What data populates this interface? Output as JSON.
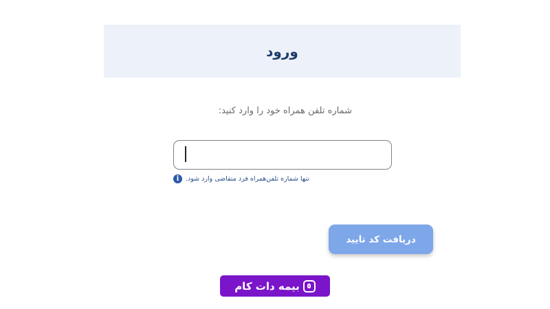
{
  "header": {
    "title": "ورود"
  },
  "form": {
    "prompt": "شماره تلفن همراه خود را وارد کنید:",
    "phone_input": {
      "value": "",
      "placeholder": ""
    },
    "hint_icon": "info-icon",
    "hint": "تنها شماره تلفن‌همراه فرد متقاضی وارد شود.",
    "submit_label": "دریافت کد تایید"
  },
  "brand": {
    "name": "بیمه دات کام",
    "icon": "bimeh-logo-icon",
    "color": "#7b15c9"
  },
  "colors": {
    "header_bg": "#edf1f9",
    "title": "#1d3a6b",
    "button": "#7ea7ea",
    "hint": "#2b4d86"
  }
}
